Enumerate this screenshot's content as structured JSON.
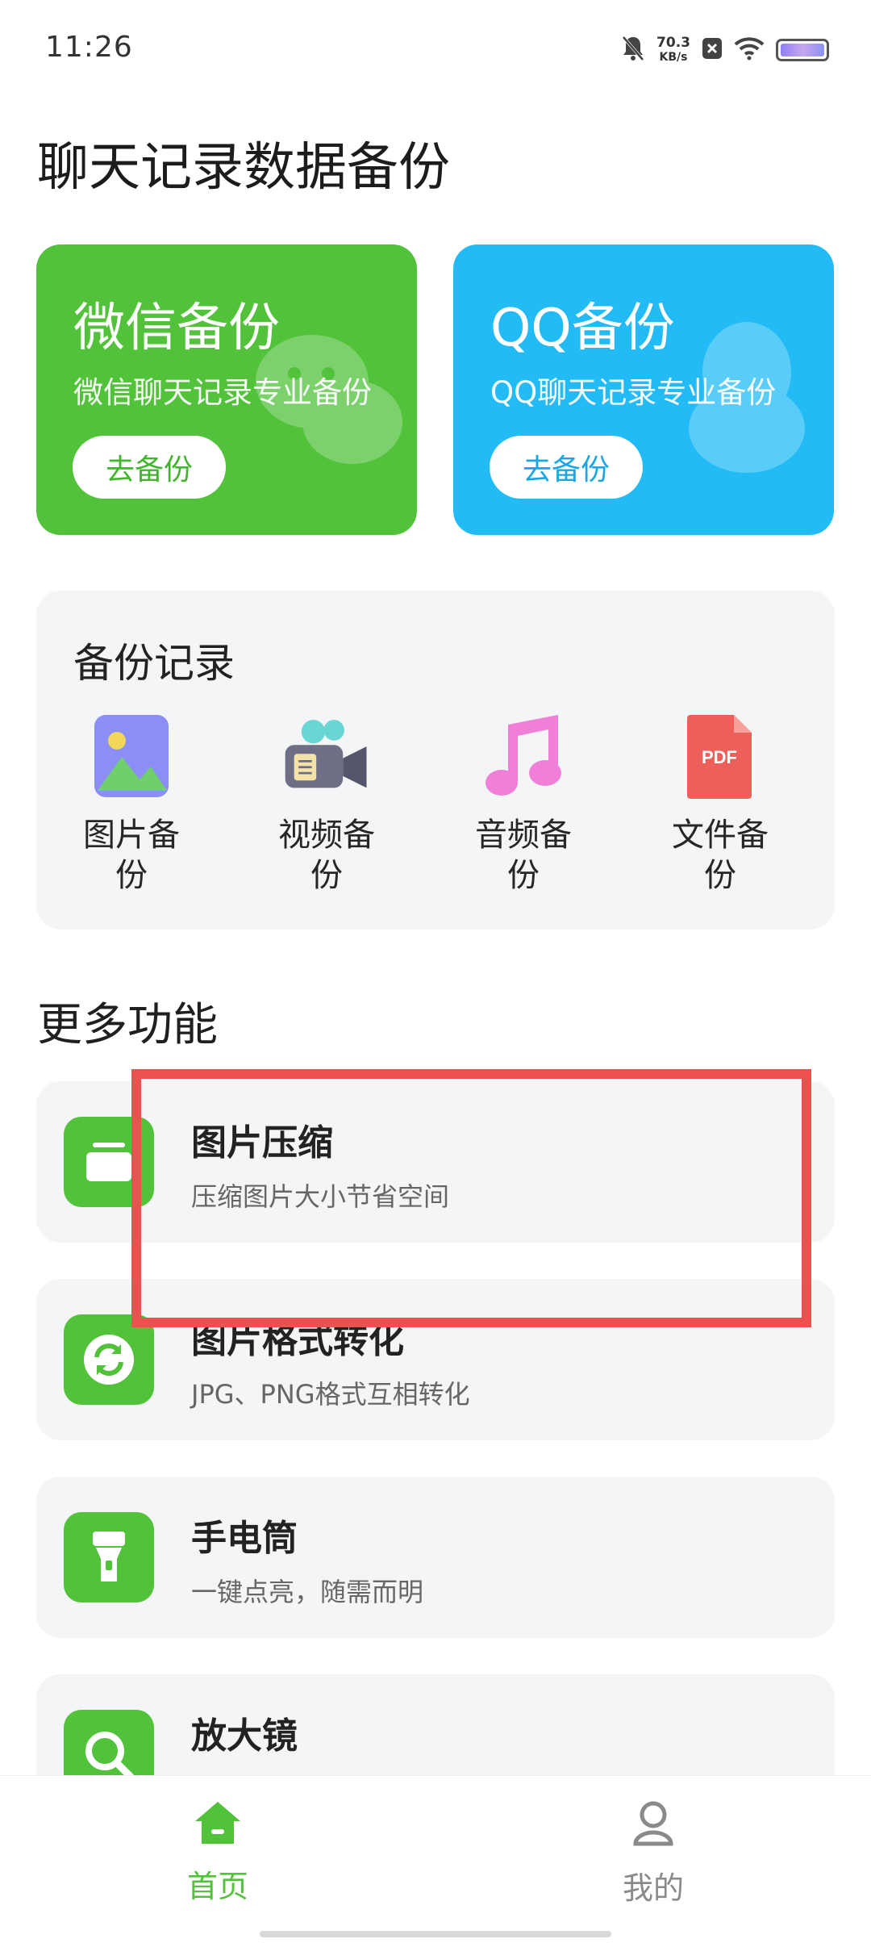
{
  "status_bar": {
    "time": "11:26",
    "net_speed_value": "70.3",
    "net_speed_unit": "KB/s",
    "icons": [
      "bell-muted-icon",
      "x-box-icon",
      "wifi-icon",
      "battery-icon"
    ]
  },
  "page_title": "聊天记录数据备份",
  "hero_cards": [
    {
      "title": "微信备份",
      "subtitle": "微信聊天记录专业备份",
      "button": "去备份",
      "color": "#52c23a",
      "icon": "wechat-icon"
    },
    {
      "title": "QQ备份",
      "subtitle": "QQ聊天记录专业备份",
      "button": "去备份",
      "color": "#22bbf6",
      "icon": "qq-penguin-icon"
    }
  ],
  "records": {
    "title": "备份记录",
    "items": [
      {
        "label": "图片备份",
        "icon": "image-icon"
      },
      {
        "label": "视频备份",
        "icon": "video-camera-icon"
      },
      {
        "label": "音频备份",
        "icon": "music-note-icon"
      },
      {
        "label": "文件备份",
        "icon": "pdf-file-icon"
      }
    ],
    "pdf_badge": "PDF"
  },
  "more_title": "更多功能",
  "features": [
    {
      "title": "图片压缩",
      "subtitle": "压缩图片大小节省空间",
      "icon": "compress-icon"
    },
    {
      "title": "图片格式转化",
      "subtitle": "JPG、PNG格式互相转化",
      "icon": "refresh-icon"
    },
    {
      "title": "手电筒",
      "subtitle": "一键点亮，随需而明",
      "icon": "flashlight-icon"
    },
    {
      "title": "放大镜",
      "subtitle": "",
      "icon": "magnifier-icon"
    }
  ],
  "bottom_nav": {
    "home": "首页",
    "mine": "我的"
  },
  "colors": {
    "green": "#52c23a",
    "blue": "#22bbf6",
    "highlight": "#e9524f"
  }
}
